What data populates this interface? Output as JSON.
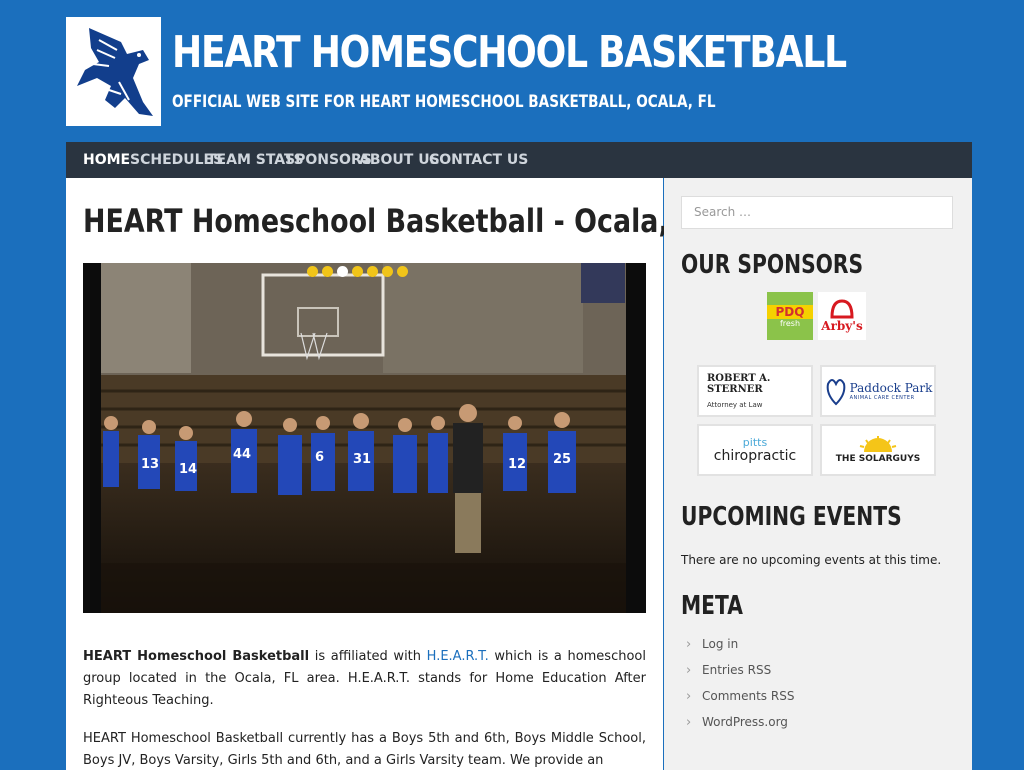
{
  "header": {
    "site_title": "HEART HOMESCHOOL BASKETBALL",
    "tagline": "OFFICIAL WEB SITE FOR HEART HOMESCHOOL BASKETBALL, OCALA, FL",
    "logo_icon": "eagle-logo-icon"
  },
  "nav": {
    "items": [
      {
        "label": "HOME",
        "active": true
      },
      {
        "label": "SCHEDULES"
      },
      {
        "label": "TEAM STATS"
      },
      {
        "label": "SPONSORS"
      },
      {
        "label": "ABOUT US"
      },
      {
        "label": "CONTACT US"
      }
    ]
  },
  "main": {
    "title": "HEART Homeschool Basketball - Ocala, FL",
    "slider": {
      "dot_count": 7,
      "active_dot": 2
    },
    "paragraph1": {
      "strong": "HEART Homeschool Basketball",
      "text_a": " is affiliated with ",
      "link": "H.E.A.R.T.",
      "text_b": " which is a homeschool group located in the Ocala, FL area. H.E.A.R.T. stands for Home Education After Righteous Teaching."
    },
    "paragraph2": "HEART Homeschool Basketball currently has a Boys 5th and 6th, Boys Middle School, Boys JV,  Boys Varsity, Girls 5th and 6th, and a Girls Varsity team. We provide an"
  },
  "sidebar": {
    "search_placeholder": "Search …",
    "sponsors_title": "OUR SPONSORS",
    "sponsors": {
      "pdq": {
        "line1": "PDQ",
        "line2": "fresh"
      },
      "arbys": "Arby's",
      "sterner": {
        "name": "ROBERT A. STERNER",
        "sub": "Attorney at Law"
      },
      "paddock": {
        "name": "Paddock Park",
        "sub": "ANIMAL CARE CENTER"
      },
      "pitts": {
        "top": "pitts",
        "main": "chiropractic"
      },
      "solar": "THE SOLARGUYS"
    },
    "events_title": "UPCOMING EVENTS",
    "no_events": "There are no upcoming events at this time.",
    "meta_title": "META",
    "meta_items": [
      "Log in",
      "Entries RSS",
      "Comments RSS",
      "WordPress.org"
    ]
  },
  "colors": {
    "background": "#1b6fbd",
    "nav_bg": "#2a3440",
    "slider_dot": "#f0c419",
    "link": "#1b6fbd"
  }
}
